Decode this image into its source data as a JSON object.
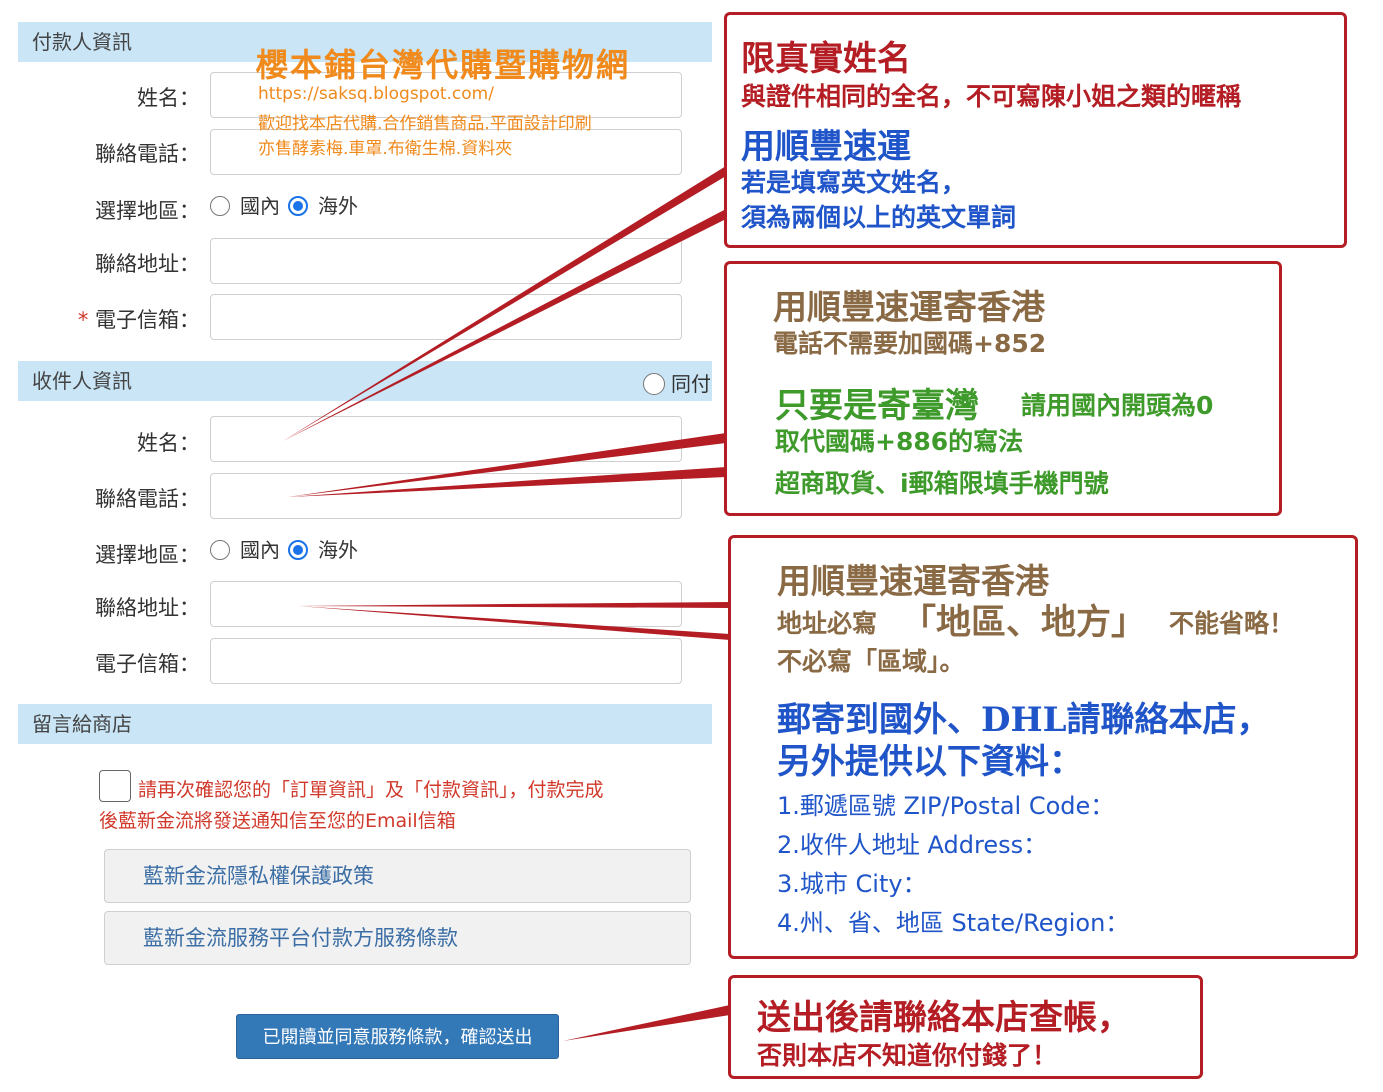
{
  "payer": {
    "section_title": "付款人資訊",
    "name_label": "姓名：",
    "phone_label": "聯絡電話：",
    "region_label": "選擇地區：",
    "region_domestic": "國內",
    "region_overseas": "海外",
    "address_label": "聯絡地址：",
    "email_required_mark": "*",
    "email_label": "電子信箱："
  },
  "recipient": {
    "section_title": "收件人資訊",
    "same_as_payer": "同付",
    "name_label": "姓名：",
    "phone_label": "聯絡電話：",
    "region_label": "選擇地區：",
    "region_domestic": "國內",
    "region_overseas": "海外",
    "address_label": "聯絡地址：",
    "email_label": "電子信箱："
  },
  "message": {
    "section_title": "留言給商店"
  },
  "confirm": {
    "line1": "請再次確認您的「訂單資訊」及「付款資訊」，付款完成",
    "line2": "後藍新金流將發送通知信至您的Email信箱"
  },
  "policies": {
    "privacy": "藍新金流隱私權保護政策",
    "terms": "藍新金流服務平台付款方服務條款"
  },
  "submit_label": "已閱讀並同意服務條款，確認送出",
  "watermark": {
    "title": "櫻本鋪台灣代購暨購物網",
    "url": "https://saksq.blogspot.com/",
    "line1": "歡迎找本店代購.合作銷售商品.平面設計印刷",
    "line2": "亦售酵素梅.車罩.布衛生棉.資料夾"
  },
  "notes": {
    "n1": {
      "title": "限真實姓名",
      "sub": "與證件相同的全名，不可寫陳小姐之類的暱稱",
      "sf_title": "用順豐速運",
      "sf_line1": "若是填寫英文姓名，",
      "sf_line2": "須為兩個以上的英文單詞"
    },
    "n2": {
      "title": "用順豐速運寄香港",
      "sub": "電話不需要加國碼+852",
      "tw_title": "只要是寄臺灣",
      "tw_rest": "請用國內開頭為0",
      "tw_line2": "取代國碼+886的寫法",
      "tw_line3": "超商取貨、i郵箱限填手機門號"
    },
    "n3": {
      "title": "用順豐速運寄香港",
      "addr_pre": "地址必寫",
      "addr_big": "「地區、地方」",
      "addr_post": "不能省略！",
      "addr_line2": "不必寫「區域」。",
      "intl_line1": "郵寄到國外、DHL請聯絡本店，",
      "intl_line2": "另外提供以下資料：",
      "item1": "1.郵遞區號 ZIP/Postal Code：",
      "item2": "2.收件人地址 Address：",
      "item3": "3.城市 City：",
      "item4": "4.州、省、地區 State/Region："
    },
    "n4": {
      "line1": "送出後請聯絡本店查帳，",
      "line2": "否則本店不知道你付錢了！"
    }
  },
  "colors": {
    "red": "#b31d23",
    "brown": "#8a6a45",
    "blue": "#1f55c8",
    "green": "#3e9a2a",
    "section": "#c9e5f6"
  }
}
